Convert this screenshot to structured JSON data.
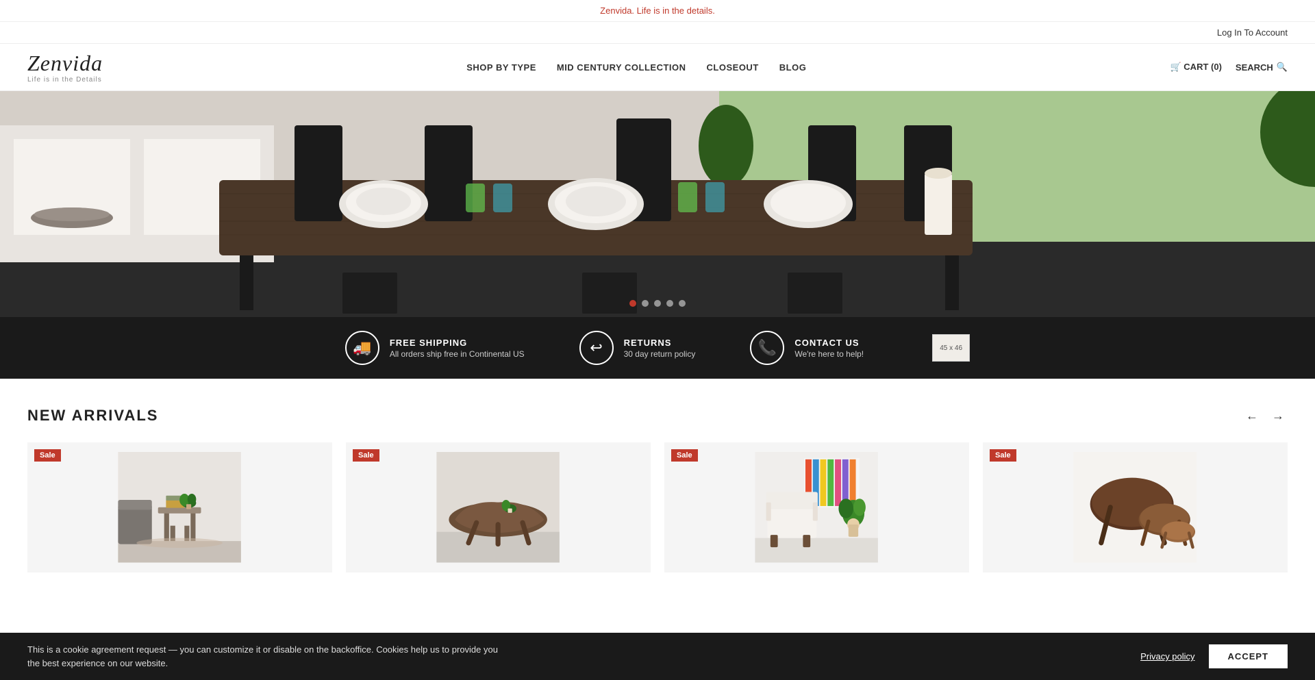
{
  "announcement": {
    "text": "Zenvida. Life is in the details."
  },
  "utility": {
    "login_label": "Log In To Account"
  },
  "header": {
    "logo": {
      "title": "Zenvida",
      "subtitle": "Life is in the Details"
    },
    "nav": [
      {
        "label": "SHOP BY TYPE",
        "id": "shop-by-type"
      },
      {
        "label": "MID CENTURY COLLECTION",
        "id": "mid-century"
      },
      {
        "label": "CLOSEOUT",
        "id": "closeout"
      },
      {
        "label": "BLOG",
        "id": "blog"
      }
    ],
    "cart": {
      "label": "CART (0)"
    },
    "search": {
      "label": "SEARCH"
    }
  },
  "hero": {
    "dots": [
      {
        "active": true
      },
      {
        "active": false
      },
      {
        "active": false
      },
      {
        "active": false
      },
      {
        "active": false
      }
    ]
  },
  "features": [
    {
      "id": "free-shipping",
      "icon": "🚚",
      "title": "FREE SHIPPING",
      "description": "All orders ship free in Continental US"
    },
    {
      "id": "returns",
      "icon": "↩",
      "title": "RETURNS",
      "description": "30 day return policy"
    },
    {
      "id": "contact-us",
      "icon": "📞",
      "title": "CONTACT US",
      "description": "We're here to help!"
    },
    {
      "id": "size-swatch",
      "label": "45 x 46"
    }
  ],
  "new_arrivals": {
    "section_title": "NEW ARRIVALS",
    "prev_arrow": "←",
    "next_arrow": "→",
    "products": [
      {
        "id": "product-1",
        "sale": true,
        "sale_label": "Sale",
        "type": "side-table"
      },
      {
        "id": "product-2",
        "sale": true,
        "sale_label": "Sale",
        "type": "coffee-table"
      },
      {
        "id": "product-3",
        "sale": true,
        "sale_label": "Sale",
        "type": "accent-chair"
      },
      {
        "id": "product-4",
        "sale": true,
        "sale_label": "Sale",
        "type": "nesting-tables"
      }
    ]
  },
  "cookie": {
    "text": "This is a cookie agreement request — you can customize it or disable on the backoffice. Cookies help us to provide you the best experience on our website.",
    "privacy_label": "Privacy policy",
    "accept_label": "ACCEPT"
  }
}
